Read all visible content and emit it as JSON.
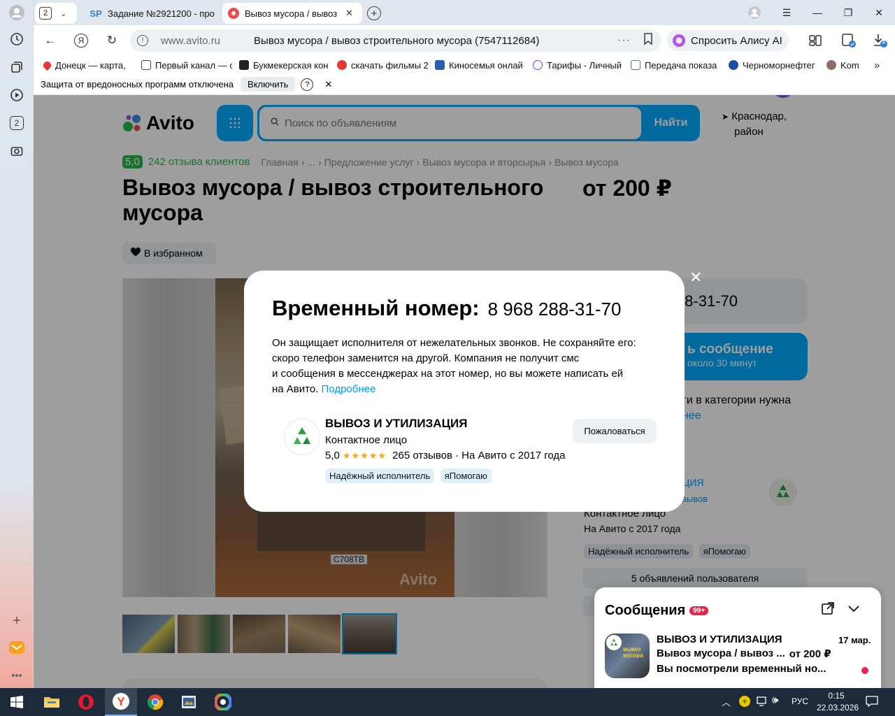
{
  "browser": {
    "tabs": [
      {
        "label": "2",
        "kind": "counter"
      },
      {
        "label": "Задание №2921200 - про",
        "favicon": "SP"
      },
      {
        "label": "Вывоз мусора / вывоз",
        "active": true
      }
    ],
    "address": {
      "domain": "www.avito.ru",
      "title": "Вывоз мусора / вывоз строительного мусора (7547112684)"
    },
    "alice_label": "Спросить Алису AI",
    "downloads_badge": "1",
    "bookmarks": [
      "Донецк — карта, ",
      "Первый канал — с",
      "Букмекерская кон",
      "скачать фильмы 2",
      "Киносемья онлай",
      "Тарифы - Личный",
      "Передача показа",
      "Черноморнефтег",
      "Kom"
    ],
    "protection": {
      "text": "Защита от вредоносных программ отключена",
      "button": "Включить",
      "help": "?"
    },
    "sidebar_badge": "2"
  },
  "avito": {
    "logo": "Avito",
    "search_placeholder": "Поиск по объявлениям",
    "search_button": "Найти",
    "location_line1": "Краснодар,",
    "location_line2": "район",
    "rating": "5,0",
    "reviews_link": "242 отзыва клиентов",
    "breadcrumbs": [
      "Главная",
      "...",
      "Предложение услуг",
      "Вывоз мусора и вторсырья",
      "Вывоз мусора"
    ],
    "title_line1": "Вывоз мусора / вывоз строительного",
    "title_line2": "мусора",
    "price": "от 200 ₽",
    "favorite": "В избранном",
    "watermark": "Avito",
    "plate": "С708ТВ",
    "phone_partial": "288-31-70",
    "message_btn_main": "ь сообщение",
    "message_btn_sub": "около 30 минут",
    "side_text1": "ги в категории нужна",
    "side_text2": "нее",
    "seller_partial": "ЦИЯ",
    "reviews_partial": "зывов",
    "contact": "Контактное лицо",
    "since": "На Авито с 2017 года",
    "badge1": "Надёжный исполнитель",
    "badge2": "яПомогаю",
    "more_ads": "5 объявлений пользователя"
  },
  "modal": {
    "title": "Временный номер:",
    "phone": "8 968 288-31-70",
    "desc_line1": "Он защищает исполнителя от нежелательных звонков. Не сохраняйте его:",
    "desc_line2": "скоро телефон заменится на другой. Компания не получит смс",
    "desc_line3": "и сообщения в мессенджерах на этот номер, но вы можете написать ей",
    "desc_line4": "на Авито.",
    "more_link": "Подробнее",
    "seller_name": "ВЫВОЗ И УТИЛИЗАЦИЯ",
    "seller_role": "Контактное лицо",
    "rating": "5,0",
    "stars": "★★★★★",
    "reviews": "265 отзывов",
    "since": "· На Авито с 2017 года",
    "badge1": "Надёжный исполнитель",
    "badge2": "яПомогаю",
    "report": "Пожаловаться",
    "close": "✕"
  },
  "messages": {
    "title": "Сообщения",
    "badge": "99+",
    "chat_name": "ВЫВОЗ И УТИЛИЗАЦИЯ",
    "chat_date": "17 мар.",
    "chat_ad": "Вывоз мусора / вывоз ...",
    "chat_price": "от 200 ₽",
    "chat_last": "Вы посмотрели временный но...",
    "thumb_text": "вывоз мусора"
  },
  "taskbar": {
    "lang": "РУС",
    "time": "0:15",
    "date": "22.03.2026"
  }
}
